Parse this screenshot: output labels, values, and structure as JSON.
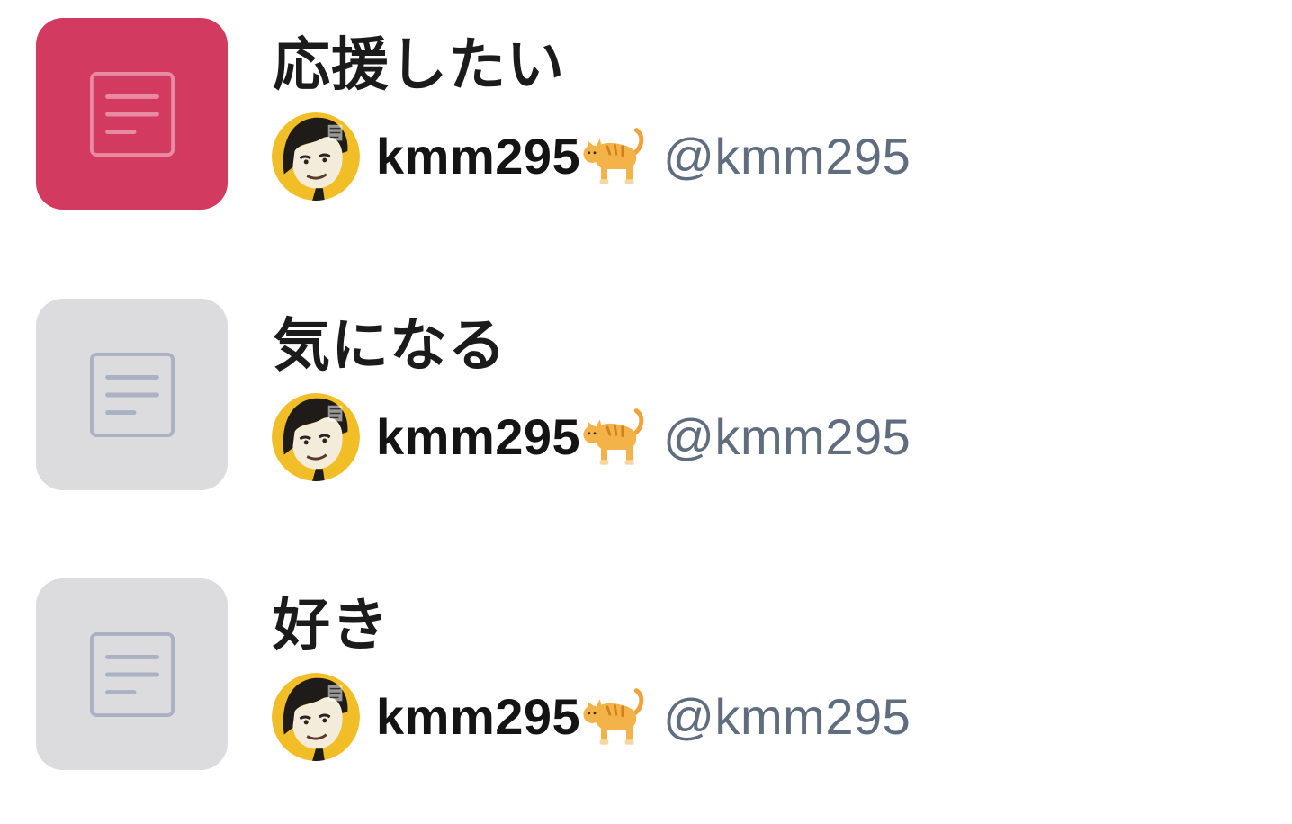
{
  "colors": {
    "active_thumb": "#d23a60",
    "inactive_thumb": "#dcdcdf",
    "active_icon": "#e88aa3",
    "inactive_icon": "#a9b1c3",
    "handle_text": "#5f6d7e",
    "avatar_background": "#f2be28"
  },
  "lists": [
    {
      "title": "応援したい",
      "icon": "document-icon",
      "selected": true,
      "owner": {
        "display_name": "kmm295",
        "emoji": "cat-icon",
        "handle": "@kmm295"
      }
    },
    {
      "title": "気になる",
      "icon": "document-icon",
      "selected": false,
      "owner": {
        "display_name": "kmm295",
        "emoji": "cat-icon",
        "handle": "@kmm295"
      }
    },
    {
      "title": "好き",
      "icon": "document-icon",
      "selected": false,
      "owner": {
        "display_name": "kmm295",
        "emoji": "cat-icon",
        "handle": "@kmm295"
      }
    }
  ]
}
